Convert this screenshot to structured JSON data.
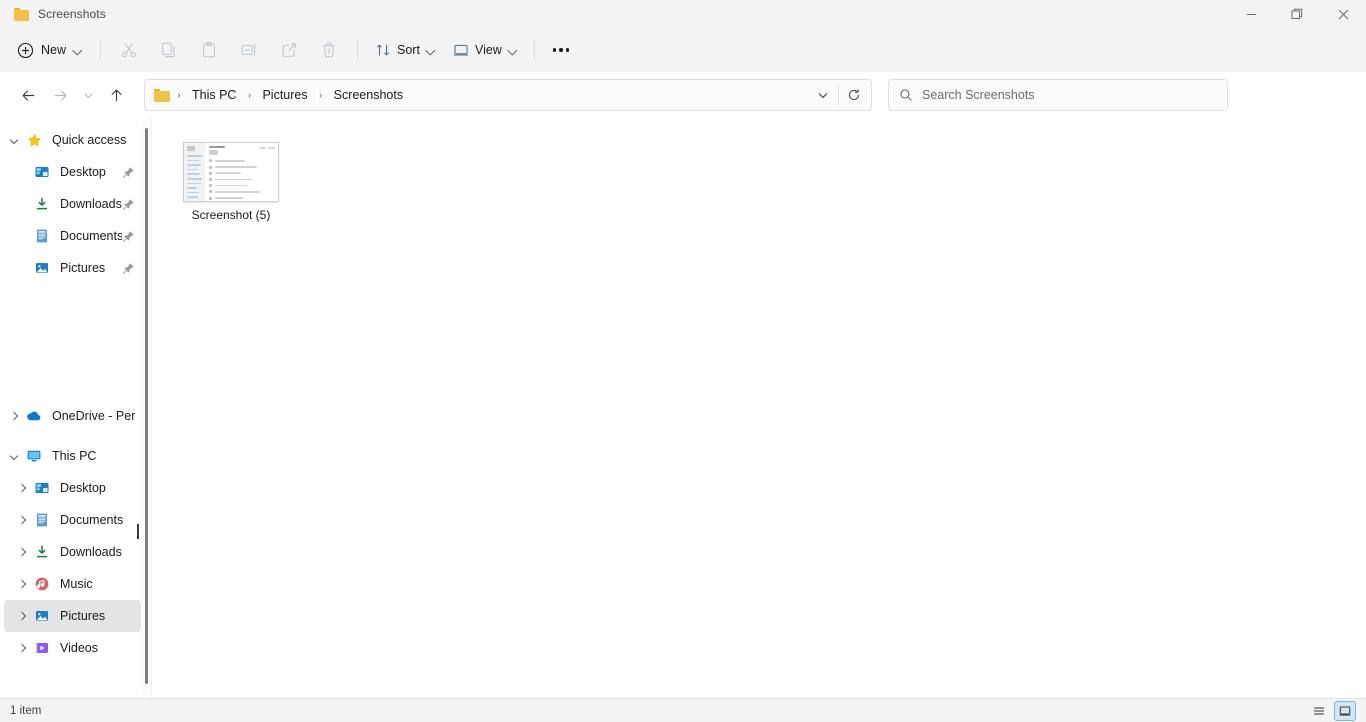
{
  "window": {
    "title": "Screenshots",
    "controls": {
      "minimize": "Minimize",
      "maximize": "Restore Down",
      "close": "Close"
    }
  },
  "toolbar": {
    "new_label": "New",
    "cut_label": "Cut",
    "copy_label": "Copy",
    "paste_label": "Paste",
    "rename_label": "Rename",
    "share_label": "Share",
    "delete_label": "Delete",
    "sort_label": "Sort",
    "view_label": "View",
    "more_label": "See more"
  },
  "navigation": {
    "back_label": "Back",
    "forward_label": "Forward",
    "recent_label": "Recent locations",
    "up_label": "Up to Pictures"
  },
  "address": {
    "breadcrumbs": [
      "This PC",
      "Pictures",
      "Screenshots"
    ],
    "separator": "›",
    "dropdown_label": "Previous Locations",
    "refresh_label": "Refresh"
  },
  "search": {
    "placeholder": "Search Screenshots",
    "value": ""
  },
  "sidebar": {
    "quick_access": {
      "label": "Quick access",
      "icon": "star-icon",
      "expanded": true,
      "items": [
        {
          "label": "Desktop",
          "icon": "desktop-icon",
          "pinned": true
        },
        {
          "label": "Downloads",
          "icon": "downloads-icon",
          "pinned": true
        },
        {
          "label": "Documents",
          "icon": "documents-icon",
          "pinned": true
        },
        {
          "label": "Pictures",
          "icon": "pictures-icon",
          "pinned": true
        }
      ]
    },
    "onedrive": {
      "label": "OneDrive - Perso",
      "icon": "cloud-icon",
      "expanded": false
    },
    "this_pc": {
      "label": "This PC",
      "icon": "monitor-icon",
      "expanded": true,
      "items": [
        {
          "label": "Desktop",
          "icon": "desktop-icon",
          "selected": false
        },
        {
          "label": "Documents",
          "icon": "documents-icon",
          "selected": false
        },
        {
          "label": "Downloads",
          "icon": "downloads-icon",
          "selected": false
        },
        {
          "label": "Music",
          "icon": "music-icon",
          "selected": false
        },
        {
          "label": "Pictures",
          "icon": "pictures-icon",
          "selected": true
        },
        {
          "label": "Videos",
          "icon": "videos-icon",
          "selected": false
        }
      ]
    }
  },
  "files": [
    {
      "name": "Screenshot (5)",
      "type": "image-thumbnail"
    }
  ],
  "status": {
    "item_count": "1 item",
    "view_list_label": "Details view",
    "view_tiles_label": "Large icons view",
    "active_view": "tiles"
  },
  "colors": {
    "chrome": "#f3f3f3",
    "content": "#ffffff",
    "selection": "#e4e4e4",
    "accent": "#cfe6f3",
    "accent_border": "#7fb4d4",
    "folder_yellow": "#f3c04a",
    "star_gold": "#f5c518",
    "onedrive_blue": "#0f7ac7"
  }
}
